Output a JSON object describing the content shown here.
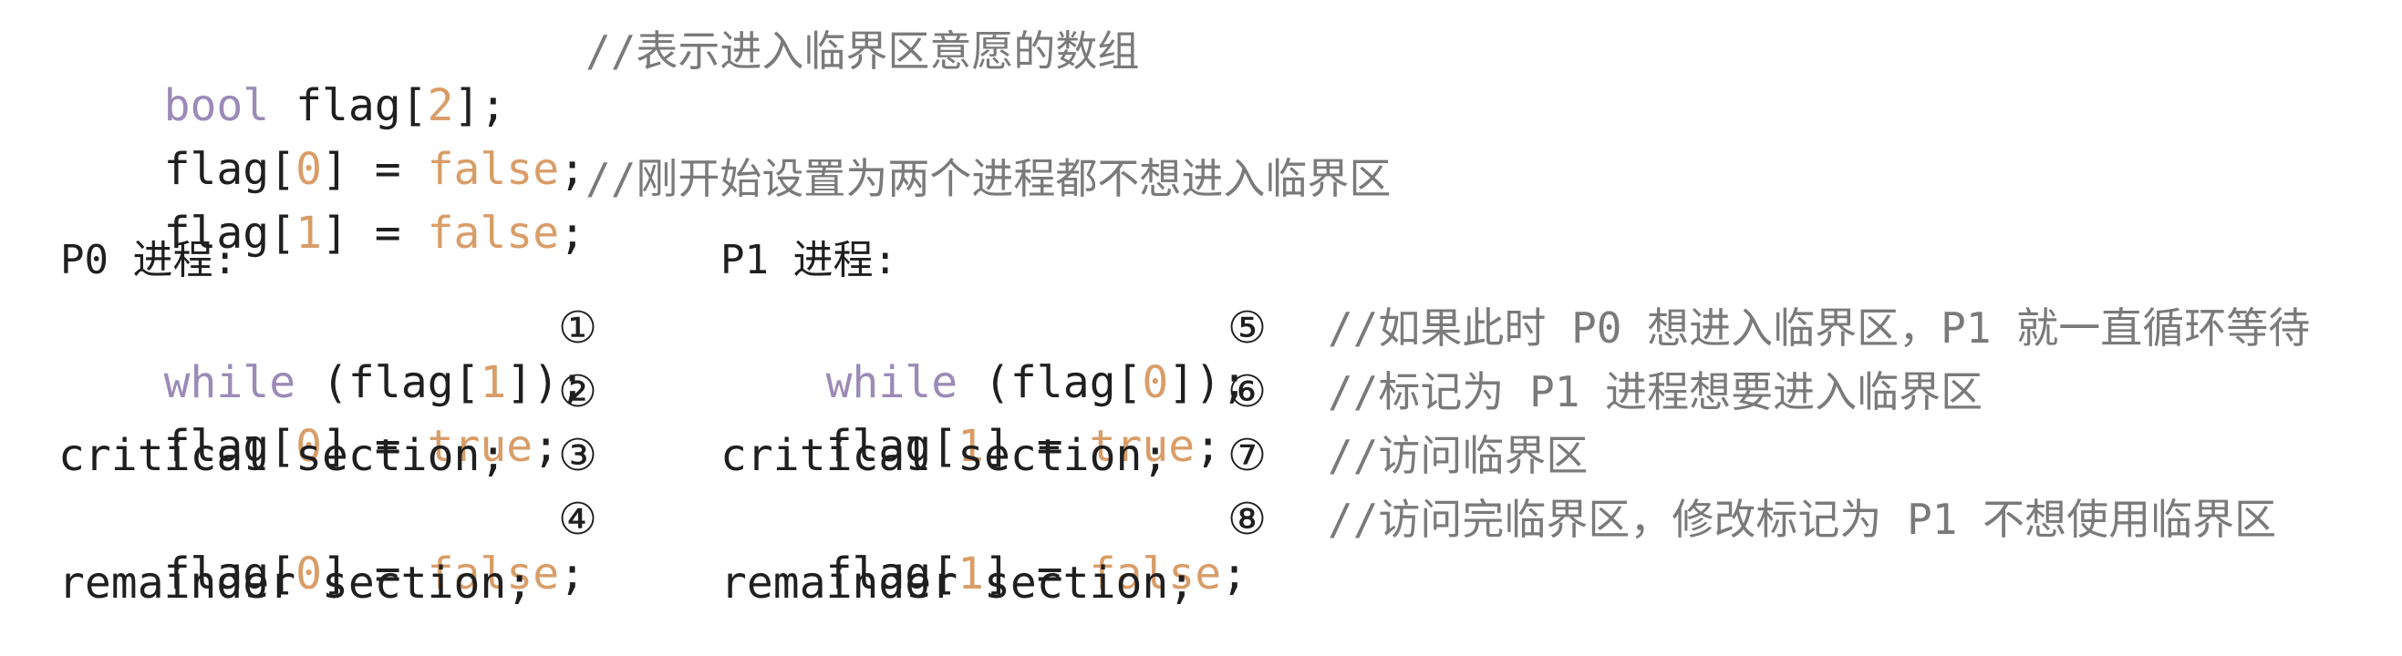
{
  "header": {
    "decl": {
      "type_kw": "bool",
      "name": "flag[",
      "idx": "2",
      "close": "];"
    },
    "decl_comment": "//表示进入临界区意愿的数组",
    "init0": {
      "lhs": "flag[",
      "idx": "0",
      "mid": "] = ",
      "val": "false",
      "end": ";"
    },
    "init1": {
      "lhs": "flag[",
      "idx": "1",
      "mid": "] = ",
      "val": "false",
      "end": ";"
    },
    "init_comment": "//刚开始设置为两个进程都不想进入临界区"
  },
  "p0": {
    "title": "P0 进程:",
    "l1": {
      "kw": "while",
      "rest1": " (flag[",
      "idx": "1",
      "rest2": "]);"
    },
    "l2": {
      "lhs": "flag[",
      "idx": "0",
      "mid": "] = ",
      "val": "true",
      "end": ";"
    },
    "l3": "critical section;",
    "l4": {
      "lhs": "flag[",
      "idx": "0",
      "mid": "] = ",
      "val": "false",
      "end": ";"
    },
    "l5": "remainder section;",
    "markers": [
      "①",
      "②",
      "③",
      "④"
    ]
  },
  "p1": {
    "title": "P1 进程:",
    "l1": {
      "kw": "while",
      "rest1": " (flag[",
      "idx": "0",
      "rest2": "]);"
    },
    "l2": {
      "lhs": "flag[",
      "idx": "1",
      "mid": "] = ",
      "val": "true",
      "end": ";"
    },
    "l3": "critical section;",
    "l4": {
      "lhs": "flag[",
      "idx": "1",
      "mid": "] = ",
      "val": "false",
      "end": ";"
    },
    "l5": "remainder section;",
    "markers": [
      "⑤",
      "⑥",
      "⑦",
      "⑧"
    ],
    "comments": [
      "//如果此时 P0 想进入临界区，P1 就一直循环等待",
      "//标记为 P1 进程想要进入临界区",
      "//访问临界区",
      "//访问完临界区，修改标记为 P1 不想使用临界区"
    ]
  }
}
